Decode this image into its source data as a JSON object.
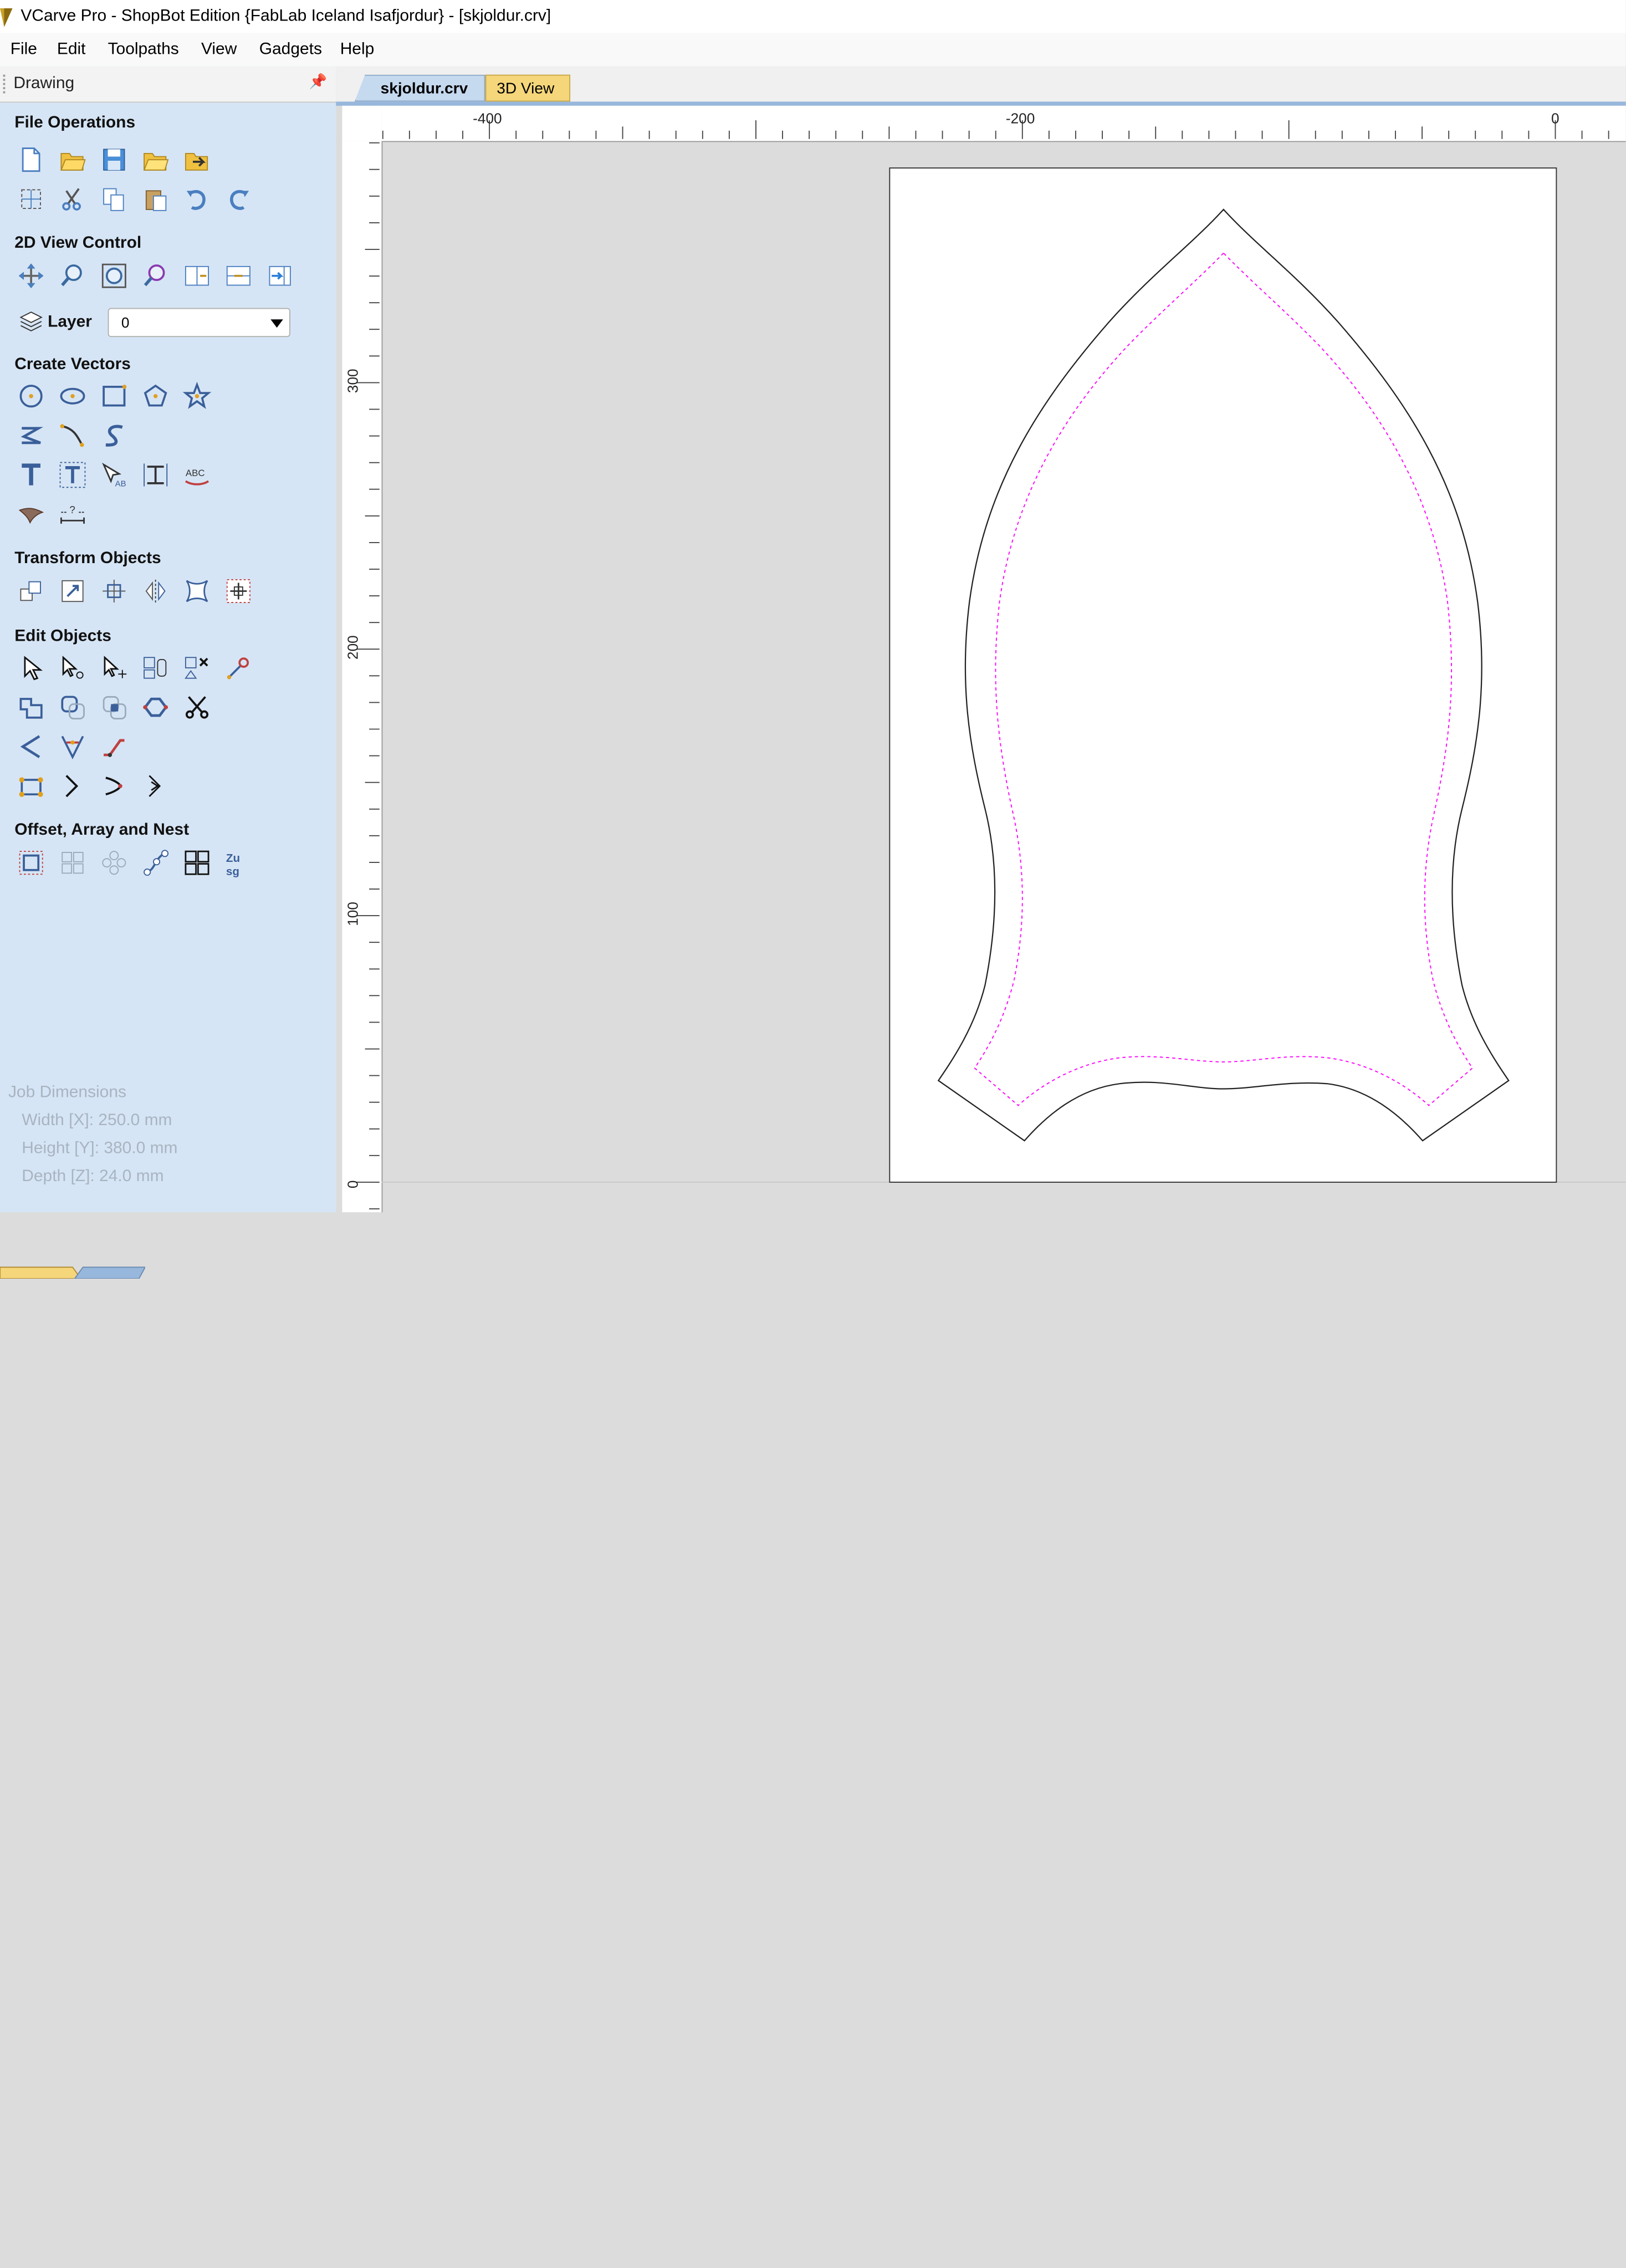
{
  "window": {
    "title": "VCarve Pro - ShopBot Edition {FabLab Iceland Isafjordur} - [skjoldur.crv]"
  },
  "menu": [
    "File",
    "Edit",
    "Toolpaths",
    "View",
    "Gadgets",
    "Help"
  ],
  "panel": {
    "title": "Drawing",
    "pin_icon": "pin-icon",
    "sections": {
      "file_operations": "File Operations",
      "view_control": "2D View Control",
      "create_vectors": "Create Vectors",
      "transform_objects": "Transform Objects",
      "edit_objects": "Edit Objects",
      "offset_array_nest": "Offset, Array and Nest"
    },
    "layer": {
      "label": "Layer",
      "value": "0"
    },
    "job_dimensions": {
      "title": "Job Dimensions",
      "width": "Width  [X]: 250.0 mm",
      "height": "Height [Y]: 380.0 mm",
      "depth": "Depth  [Z]: 24.0 mm"
    }
  },
  "tabs": [
    {
      "label": "skjoldur.crv",
      "active": true
    },
    {
      "label": "3D View",
      "active": false
    }
  ],
  "rulers": {
    "top_labels": [
      "-400",
      "-200",
      "0"
    ],
    "left_labels": [
      "300",
      "200",
      "100",
      "0"
    ]
  },
  "colors": {
    "panel_bg": "#d6e5f5",
    "canvas_bg": "#dcdcdc",
    "offset_vector": "#ff00ff",
    "vector": "#000000",
    "tab_active": "#c5d9ef",
    "tab_3d": "#f5d67a"
  }
}
